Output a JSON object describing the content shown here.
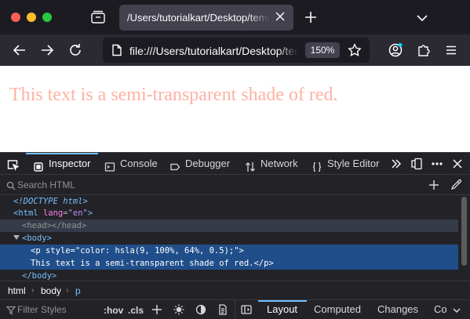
{
  "window": {
    "tab_title": "/Users/tutorialkart/Desktop/temp.html",
    "icons": [
      "tab-list-icon",
      "close-icon",
      "plus-icon",
      "chevron-down-icon"
    ]
  },
  "navbar": {
    "url": "file:///Users/tutorialkart/Desktop/temp.html",
    "zoom": "150%",
    "icons": [
      "back-arrow-icon",
      "forward-arrow-icon",
      "reload-icon",
      "page-icon",
      "star-icon",
      "account-icon",
      "extensions-icon",
      "menu-icon"
    ]
  },
  "page": {
    "text": "This text is a semi-transparent shade of red.",
    "text_color": "hsla(9, 100%, 64%, 0.5)"
  },
  "devtools": {
    "tabs": [
      {
        "label": "Inspector",
        "icon": "inspector-icon",
        "active": true
      },
      {
        "label": "Console",
        "icon": "console-icon"
      },
      {
        "label": "Debugger",
        "icon": "debugger-icon"
      },
      {
        "label": "Network",
        "icon": "network-icon"
      },
      {
        "label": "Style Editor",
        "icon": "style-editor-icon"
      }
    ],
    "search_placeholder": "Search HTML",
    "markup": {
      "doctype": "<!DOCTYPE html>",
      "html_open": "<html",
      "html_attr": "lang",
      "html_val": "\"en\"",
      "html_close": ">",
      "head": "<head></head>",
      "body_open": "<body>",
      "p_open": "<p",
      "p_attr": "style",
      "p_val": "\"color: hsla(9, 100%, 64%, 0.5);\"",
      "p_close": ">",
      "p_text": "This text is a semi-transparent shade of red.",
      "p_end": "</p>",
      "body_close": "</body>"
    },
    "breadcrumbs": [
      "html",
      "body",
      "p"
    ],
    "filter_placeholder": "Filter Styles",
    "hov": ":hov",
    "cls": ".cls",
    "side_tabs": [
      "Layout",
      "Computed",
      "Changes",
      "Co"
    ],
    "accent_color": "#75bfff"
  }
}
